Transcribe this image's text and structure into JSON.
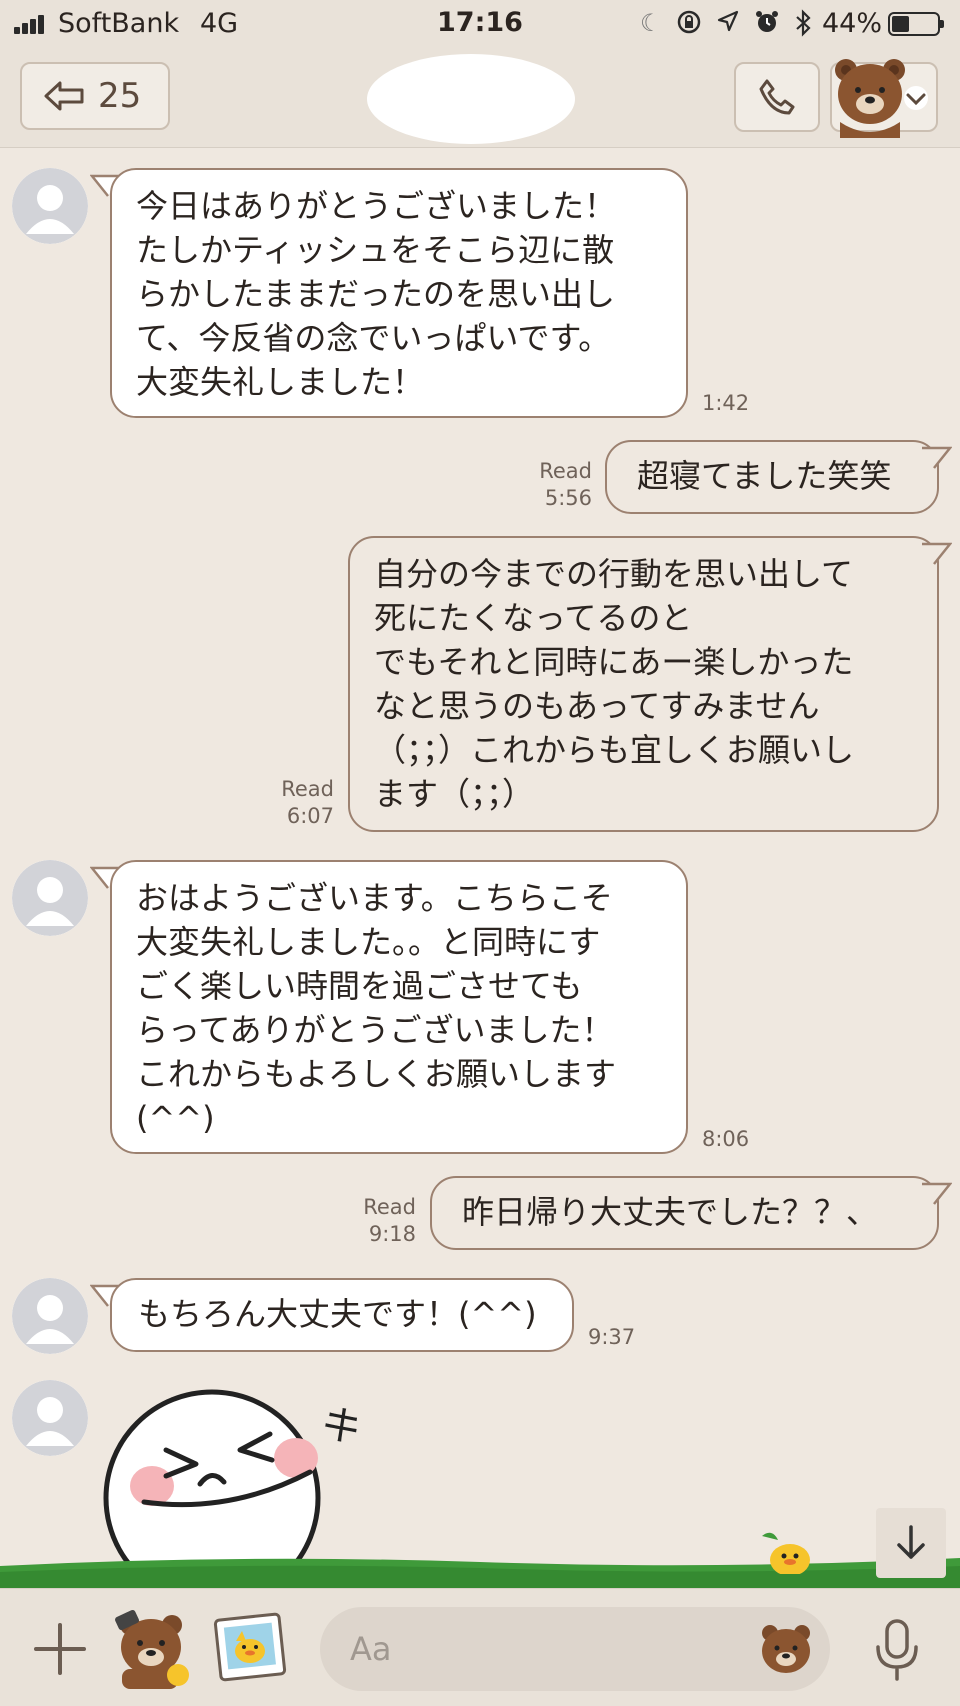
{
  "status_bar": {
    "carrier": "SoftBank",
    "network": "4G",
    "time": "17:16",
    "battery": "44%",
    "battery_level": 0.44,
    "icons": [
      "moon-icon",
      "rotation-lock-icon",
      "location-icon",
      "alarm-icon",
      "bluetooth-icon"
    ]
  },
  "header": {
    "back_count": "25",
    "icons": [
      "back-arrow-icon",
      "phone-icon",
      "bear-avatar-icon",
      "chevron-down-icon"
    ]
  },
  "messages": [
    {
      "direction": "incoming",
      "text": "今日はありがとうございました！\nたしかティッシュをそこら辺に散\nらかしたままだったのを思い出し\nて、今反省の念でいっぱいです。\n大変失礼しました！",
      "time": "1:42"
    },
    {
      "direction": "outgoing",
      "text": "超寝てました笑笑",
      "read": "Read",
      "time": "5:56"
    },
    {
      "direction": "outgoing",
      "text": "自分の今までの行動を思い出して\n死にたくなってるのと\nでもそれと同時にあー楽しかった\nなと思うのもあってすみません\n（；；）これからも宜しくお願いし\nます（；；）",
      "read": "Read",
      "time": "6:07"
    },
    {
      "direction": "incoming",
      "text": "おはようございます。こちらこそ\n大変失礼しました。。と同時にす\nごく楽しい時間を過ごさせても\nらってありがとうございました！\nこれからもよろしくお願いします\n(^^)",
      "time": "8:06"
    },
    {
      "direction": "outgoing",
      "text": "昨日帰り大丈夫でした？？、",
      "read": "Read",
      "time": "9:18"
    },
    {
      "direction": "incoming",
      "text": "もちろん大丈夫です！(^^)",
      "time": "9:37"
    },
    {
      "direction": "incoming",
      "type": "sticker",
      "sticker": "laughing-moon-sticker",
      "sticker_text": "キキ"
    }
  ],
  "input_bar": {
    "placeholder": "Aa",
    "icons": [
      "plus-icon",
      "bear-sticker-icon",
      "photo-icon",
      "bear-emoji-icon",
      "microphone-icon"
    ]
  },
  "colors": {
    "background": "#efe8e0",
    "bar": "#e9e2d9",
    "bubble_border": "#9c8170",
    "incoming_bubble": "#ffffff",
    "grass": "#3f9a3a"
  }
}
